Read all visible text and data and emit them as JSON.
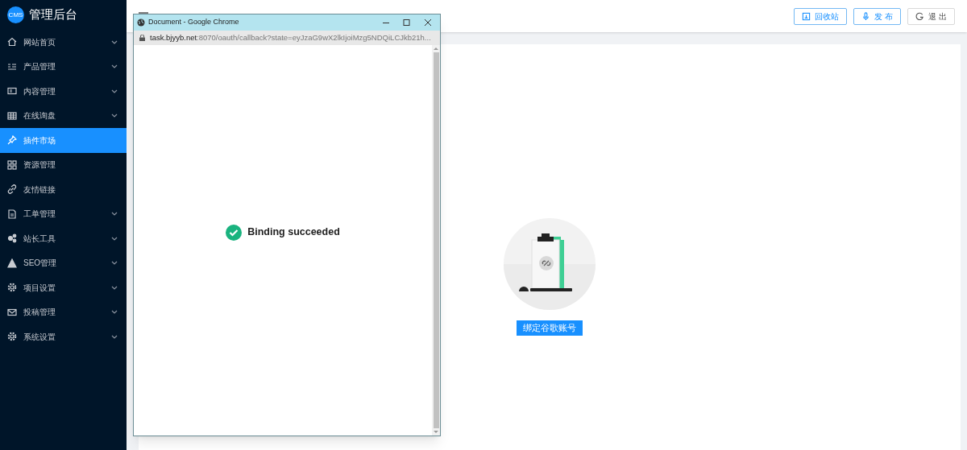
{
  "sidebar": {
    "logo": "CMS",
    "title": "管理后台",
    "items": [
      {
        "label": "网站首页",
        "expandable": true,
        "selected": false
      },
      {
        "label": "产品管理",
        "expandable": true,
        "selected": false
      },
      {
        "label": "内容管理",
        "expandable": true,
        "selected": false
      },
      {
        "label": "在线询盘",
        "expandable": true,
        "selected": false
      },
      {
        "label": "插件市场",
        "expandable": false,
        "selected": true
      },
      {
        "label": "资源管理",
        "expandable": false,
        "selected": false
      },
      {
        "label": "友情链接",
        "expandable": false,
        "selected": false
      },
      {
        "label": "工单管理",
        "expandable": true,
        "selected": false
      },
      {
        "label": "站长工具",
        "expandable": true,
        "selected": false
      },
      {
        "label": "SEO管理",
        "expandable": true,
        "selected": false
      },
      {
        "label": "项目设置",
        "expandable": true,
        "selected": false
      },
      {
        "label": "投稿管理",
        "expandable": true,
        "selected": false
      },
      {
        "label": "系统设置",
        "expandable": true,
        "selected": false
      }
    ]
  },
  "header": {
    "buttons": [
      {
        "label": "回收站",
        "kind": "primary"
      },
      {
        "label": "发 布",
        "kind": "primary"
      },
      {
        "label": "退 出",
        "kind": "default"
      }
    ]
  },
  "content": {
    "bind_button": "绑定谷歌账号"
  },
  "popup": {
    "title": "Document - Google Chrome",
    "url_host": "task.bjyyb.net",
    "url_rest": ":8070/oauth/callback?state=eyJzaG9wX2lkIjoiMzg5NDQiLCJkb21h...",
    "message": "Binding succeeded"
  }
}
